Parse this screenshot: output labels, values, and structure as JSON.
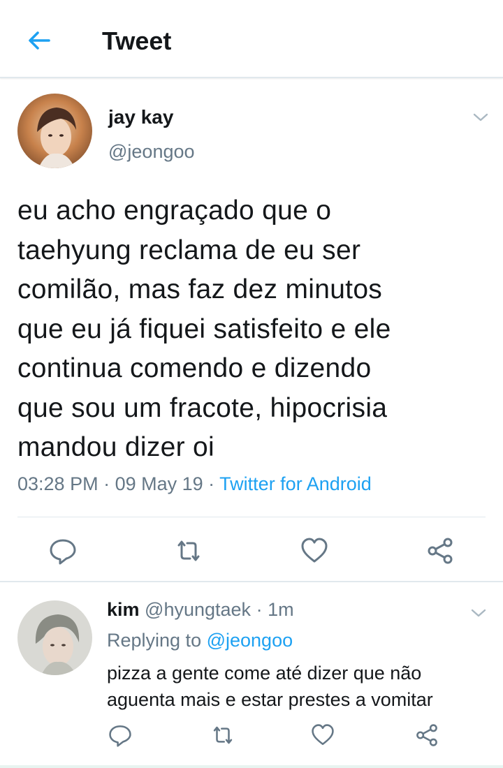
{
  "header": {
    "title": "Tweet",
    "back_icon": "arrow-left-icon",
    "accent": "#1da1f2"
  },
  "tweet": {
    "author": {
      "name": "jay kay",
      "handle": "@jeongoo"
    },
    "text_lines": [
      "eu acho engraçado que o",
      "taehyung reclama de eu ser",
      "comilão, mas faz dez minutos",
      "que eu já fiquei satisfeito e ele",
      "continua comendo e dizendo",
      "que sou um fracote, hipocrisia",
      "mandou dizer oi"
    ],
    "time": "03:28 PM",
    "date": "09 May 19",
    "separator": " · ",
    "source": "Twitter for Android",
    "actions": [
      "reply-icon",
      "retweet-icon",
      "like-icon",
      "share-icon"
    ]
  },
  "reply": {
    "name": "kim",
    "handle": "@hyungtaek",
    "separator": " · ",
    "age": "1m",
    "replying_prefix": "Replying to ",
    "replying_to": "@jeongoo",
    "text_lines": [
      "pizza a gente come até dizer que não",
      "aguenta mais e estar prestes a vomitar"
    ],
    "actions": [
      "reply-icon",
      "retweet-icon",
      "like-icon",
      "share-icon"
    ]
  },
  "colors": {
    "text": "#14171a",
    "secondary": "#657786",
    "link": "#1da1f2",
    "divider": "#e1e8ed"
  }
}
